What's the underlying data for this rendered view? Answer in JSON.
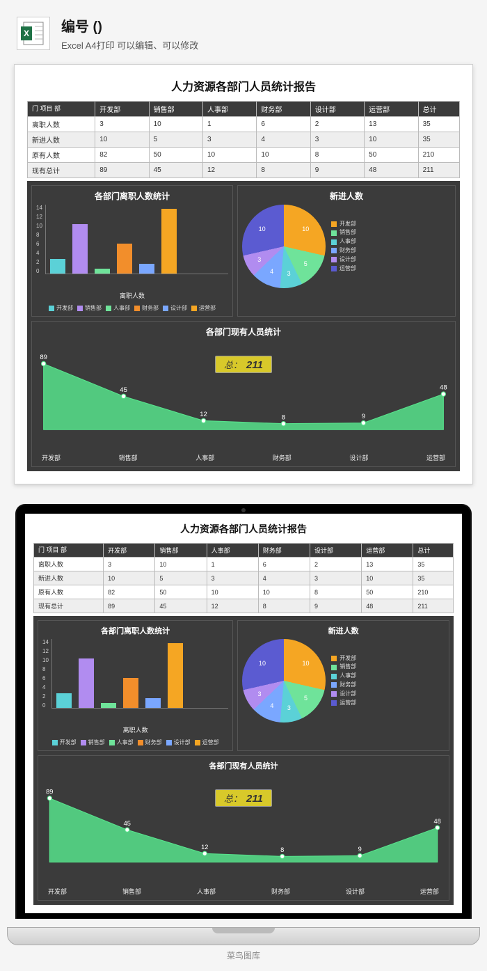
{
  "header": {
    "title": "编号 ()",
    "subtitle": "Excel A4打印 可以编辑、可以修改",
    "icon_label": "X"
  },
  "report": {
    "title": "人力资源各部门人员统计报告",
    "corner": "门\n项目 部",
    "columns": [
      "开发部",
      "销售部",
      "人事部",
      "财务部",
      "设计部",
      "运营部",
      "总计"
    ],
    "rows": [
      {
        "label": "离职人数",
        "cells": [
          3,
          10,
          1,
          6,
          2,
          13,
          35
        ]
      },
      {
        "label": "新进人数",
        "cells": [
          10,
          5,
          3,
          4,
          3,
          10,
          35
        ]
      },
      {
        "label": "原有人数",
        "cells": [
          82,
          50,
          10,
          10,
          8,
          50,
          210
        ]
      },
      {
        "label": "现有总计",
        "cells": [
          89,
          45,
          12,
          8,
          9,
          48,
          211
        ]
      }
    ]
  },
  "chart_data": [
    {
      "id": "bar",
      "type": "bar",
      "title": "各部门离职人数统计",
      "categories": [
        "开发部",
        "销售部",
        "人事部",
        "财务部",
        "设计部",
        "运营部"
      ],
      "values": [
        3,
        10,
        1,
        6,
        2,
        13
      ],
      "xlabel": "离职人数",
      "ylim": [
        0,
        14
      ],
      "y_ticks": [
        0,
        2,
        4,
        6,
        8,
        10,
        12,
        14
      ],
      "colors": [
        "#5bd1d7",
        "#b18cf0",
        "#6fe39a",
        "#f28e2b",
        "#7aa7ff",
        "#f5a623"
      ]
    },
    {
      "id": "pie",
      "type": "pie",
      "title": "新进人数",
      "categories": [
        "开发部",
        "销售部",
        "人事部",
        "财务部",
        "设计部",
        "运营部"
      ],
      "values": [
        10,
        5,
        3,
        4,
        3,
        10
      ],
      "colors": [
        "#f5a623",
        "#6fe39a",
        "#5bd1d7",
        "#7aa7ff",
        "#b18cf0",
        "#5b5bd1"
      ]
    },
    {
      "id": "area",
      "type": "area",
      "title": "各部门现有人员统计",
      "categories": [
        "开发部",
        "销售部",
        "人事部",
        "财务部",
        "设计部",
        "运营部"
      ],
      "values": [
        89,
        45,
        12,
        8,
        9,
        48
      ],
      "ylim": [
        0,
        90
      ],
      "badge_prefix": "总：",
      "total": 211,
      "color": "#57e38c"
    }
  ],
  "watermark": "菜鸟图库"
}
